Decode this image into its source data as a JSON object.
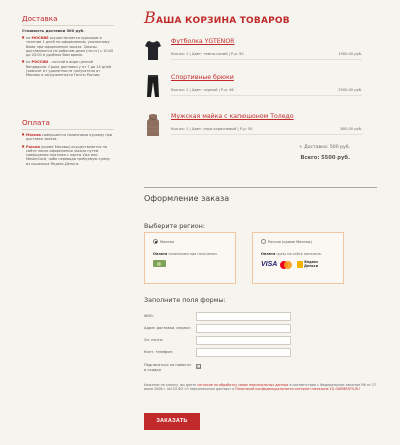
{
  "sidebar": {
    "delivery": {
      "title": "Доставка",
      "cost": "Стоимость доставки 300 руб.",
      "items": [
        {
          "pre": "по ",
          "hl": "МОСКВЕ",
          "post": " осуществляется курьером в течении 1 дней по оформлению, указанному Вами при оформлении заказа. Заказы доставляются по рабочим дням (пн-пт) с 10:00 до 20:00 в удобное Вам время."
        },
        {
          "pre": "по ",
          "hl": "РОССИИ",
          "post": " – почтой в виде ценной бандероли. Сроки доставки у от 7 до 14 дней (зависит от удаленности получателя от Москвы и загруженности Почты России."
        }
      ]
    },
    "payment": {
      "title": "Оплата",
      "items": [
        {
          "pre": "",
          "hl": "Москва",
          "post": " совершается наличными курьеру при доставке заказа."
        },
        {
          "pre": "",
          "hl": "Россия",
          "post": " (кроме Москвы) осуществляется на сайте после оформления заказа путем совершения платежа с карты Visa или MasterCard, либо перевода требуемую сумму из кошелька Яндекс.Деньги."
        }
      ]
    }
  },
  "cart": {
    "title_first": "В",
    "title_rest": "АША КОРЗИНА ТОВАРОВ",
    "items": [
      {
        "name": "Футболка YGTENOR",
        "meta": "Кол-во: 1  |  Цвет: темно-синий  |  Р-р: 50",
        "price": "1900.00 руб."
      },
      {
        "name": "Спортивные брюки",
        "meta": "Кол-во: 1  |  Цвет: черный  |  Р-р: 46",
        "price": "2500.00 руб."
      },
      {
        "name": "Мужская майка с капюшоном Толедо",
        "meta": "Кол-во: 1  |  Цвет: серо-коричневый  |  Р-р: 50",
        "price": "800.00 руб."
      }
    ],
    "delivery": "+ Доставка: 500 руб.",
    "total_label": "Всего:",
    "total_value": "5500 руб."
  },
  "order": {
    "title": "Оформление заказа",
    "region_title": "Выберите регион:",
    "regions": [
      {
        "label": "Москва",
        "pay_label": "Оплата",
        "pay_text": "наличными при получении."
      },
      {
        "label": "Россия (кроме Москвы)",
        "pay_label": "Оплата",
        "pay_text": "сразу на сайте магазина.",
        "visa": "VISA",
        "ym_line1": "Яндекс",
        "ym_line2": "Деньги"
      }
    ],
    "form_title": "Заполните поля формы:",
    "fields": [
      {
        "label": "ФИО:",
        "value": ""
      },
      {
        "label": "Адрес доставки, индекс:",
        "value": ""
      },
      {
        "label": "Эл. почта:",
        "value": ""
      },
      {
        "label": "Конт. телефон:",
        "value": ""
      }
    ],
    "subscribe_label": "Подписаться на новости и скидки",
    "subscribe_check": "☑",
    "legal": {
      "pre": "Нажатие на кнопку, вы даете ",
      "link1": "согласие на обработку своих персональных данных",
      "mid": " в соответствии с Федеральным законом РФ от 27 июля 2006 г. №152-ФЗ «О персональных данных» и ",
      "link2": "Политикой конфиденциальности интернет-магазина YG-GARMENTS.RU"
    },
    "submit": "ЗАКАЗАТЬ"
  },
  "colors": {
    "accent": "#c12a2a",
    "background": "#f6f4ef",
    "card_border": "#f1c6a3"
  }
}
